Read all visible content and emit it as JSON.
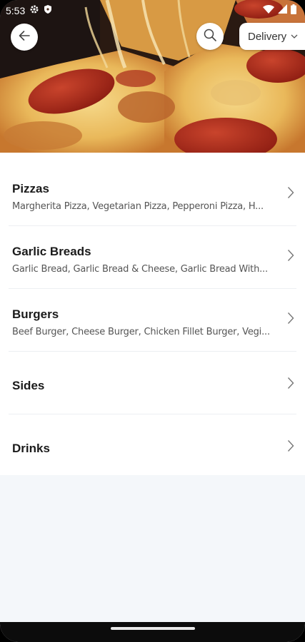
{
  "status_bar": {
    "time": "5:53",
    "icons": [
      "gear-icon",
      "shield-icon",
      "wifi-icon",
      "cellular-icon",
      "battery-icon"
    ]
  },
  "header": {
    "back_icon": "arrow-left-icon",
    "search_icon": "search-icon",
    "order_mode": "Delivery",
    "order_mode_icon": "chevron-down-icon"
  },
  "categories": [
    {
      "title": "Pizzas",
      "items": "Margherita Pizza, Vegetarian Pizza, Pepperoni Pizza, H..."
    },
    {
      "title": "Garlic Breads",
      "items": "Garlic Bread, Garlic Bread & Cheese, Garlic Bread With..."
    },
    {
      "title": "Burgers",
      "items": "Beef Burger, Cheese Burger, Chicken Fillet Burger, Vegi..."
    },
    {
      "title": "Sides",
      "items": ""
    },
    {
      "title": "Drinks",
      "items": ""
    }
  ],
  "colors": {
    "page_background": "#f4f7fa",
    "list_background": "#ffffff",
    "title_text": "#1b1b1b",
    "subtitle_text": "#555555"
  }
}
